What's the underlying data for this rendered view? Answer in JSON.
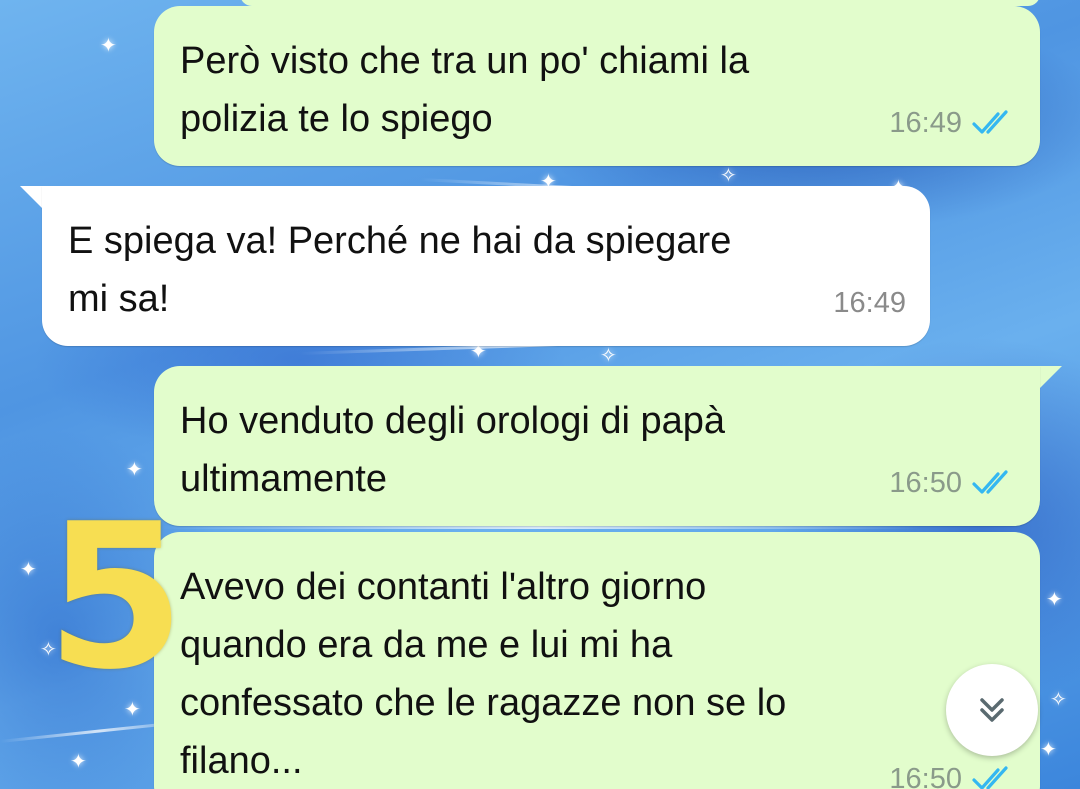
{
  "colors": {
    "outgoing_bubble": "#e2fdcc",
    "incoming_bubble": "#ffffff",
    "read_ticks": "#34b7f1",
    "overlay_number": "#f7de52"
  },
  "messages": [
    {
      "direction": "outgoing",
      "lines": [
        "Però visto che tra un po' chiami la",
        "polizia te lo spiego"
      ],
      "time": "16:49",
      "status_icon": "double-check-read-icon"
    },
    {
      "direction": "incoming",
      "lines": [
        "E spiega va! Perché ne hai da spiegare",
        "mi sa!"
      ],
      "time": "16:49"
    },
    {
      "direction": "outgoing",
      "lines": [
        "Ho venduto degli orologi di papà",
        "ultimamente"
      ],
      "time": "16:50",
      "status_icon": "double-check-read-icon"
    },
    {
      "direction": "outgoing",
      "lines": [
        "Avevo dei contanti l'altro giorno",
        "quando era da me e lui mi ha",
        "confessato che le ragazze non se lo",
        "filano..."
      ],
      "time": "16:50",
      "status_icon": "double-check-read-icon"
    }
  ],
  "overlay": {
    "number": "5"
  },
  "scroll_button": {
    "icon": "double-chevron-down-icon"
  }
}
